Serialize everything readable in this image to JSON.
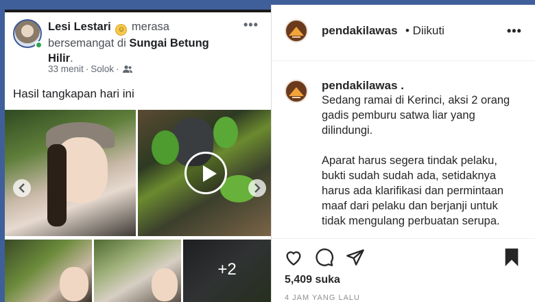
{
  "facebook_post": {
    "author": "Lesi Lestari",
    "feeling_emoji": "☺",
    "feeling_text": "merasa bersemangat di",
    "location": "Sungai Betung Hilir",
    "time": "33 menit",
    "place_tag": "Solok",
    "audience_icon": "people-icon",
    "more_icon": "•••",
    "caption": "Hasil tangkapan hari ini",
    "extra_photos": "+2"
  },
  "instagram_post": {
    "username": "pendakilawas",
    "follow_status": "• Diikuti",
    "more_icon": "•••",
    "caption_username": "pendakilawas .",
    "caption_lines": [
      "Sedang ramai di Kerinci, aksi 2 orang gadis pemburu satwa liar yang dilindungi.",
      "Aparat harus segera tindak pelaku, bukti sudah sudah ada, setidaknya harus ada klarifikasi dan permintaan maaf dari pelaku dan berjanji untuk tidak mengulang perbuatan serupa."
    ],
    "likes": "5,409 suka",
    "timestamp": "4 JAM YANG LALU"
  },
  "colors": {
    "background": "#3f5f9a",
    "facebook_online": "#31a24c",
    "instagram_text": "#262626"
  }
}
